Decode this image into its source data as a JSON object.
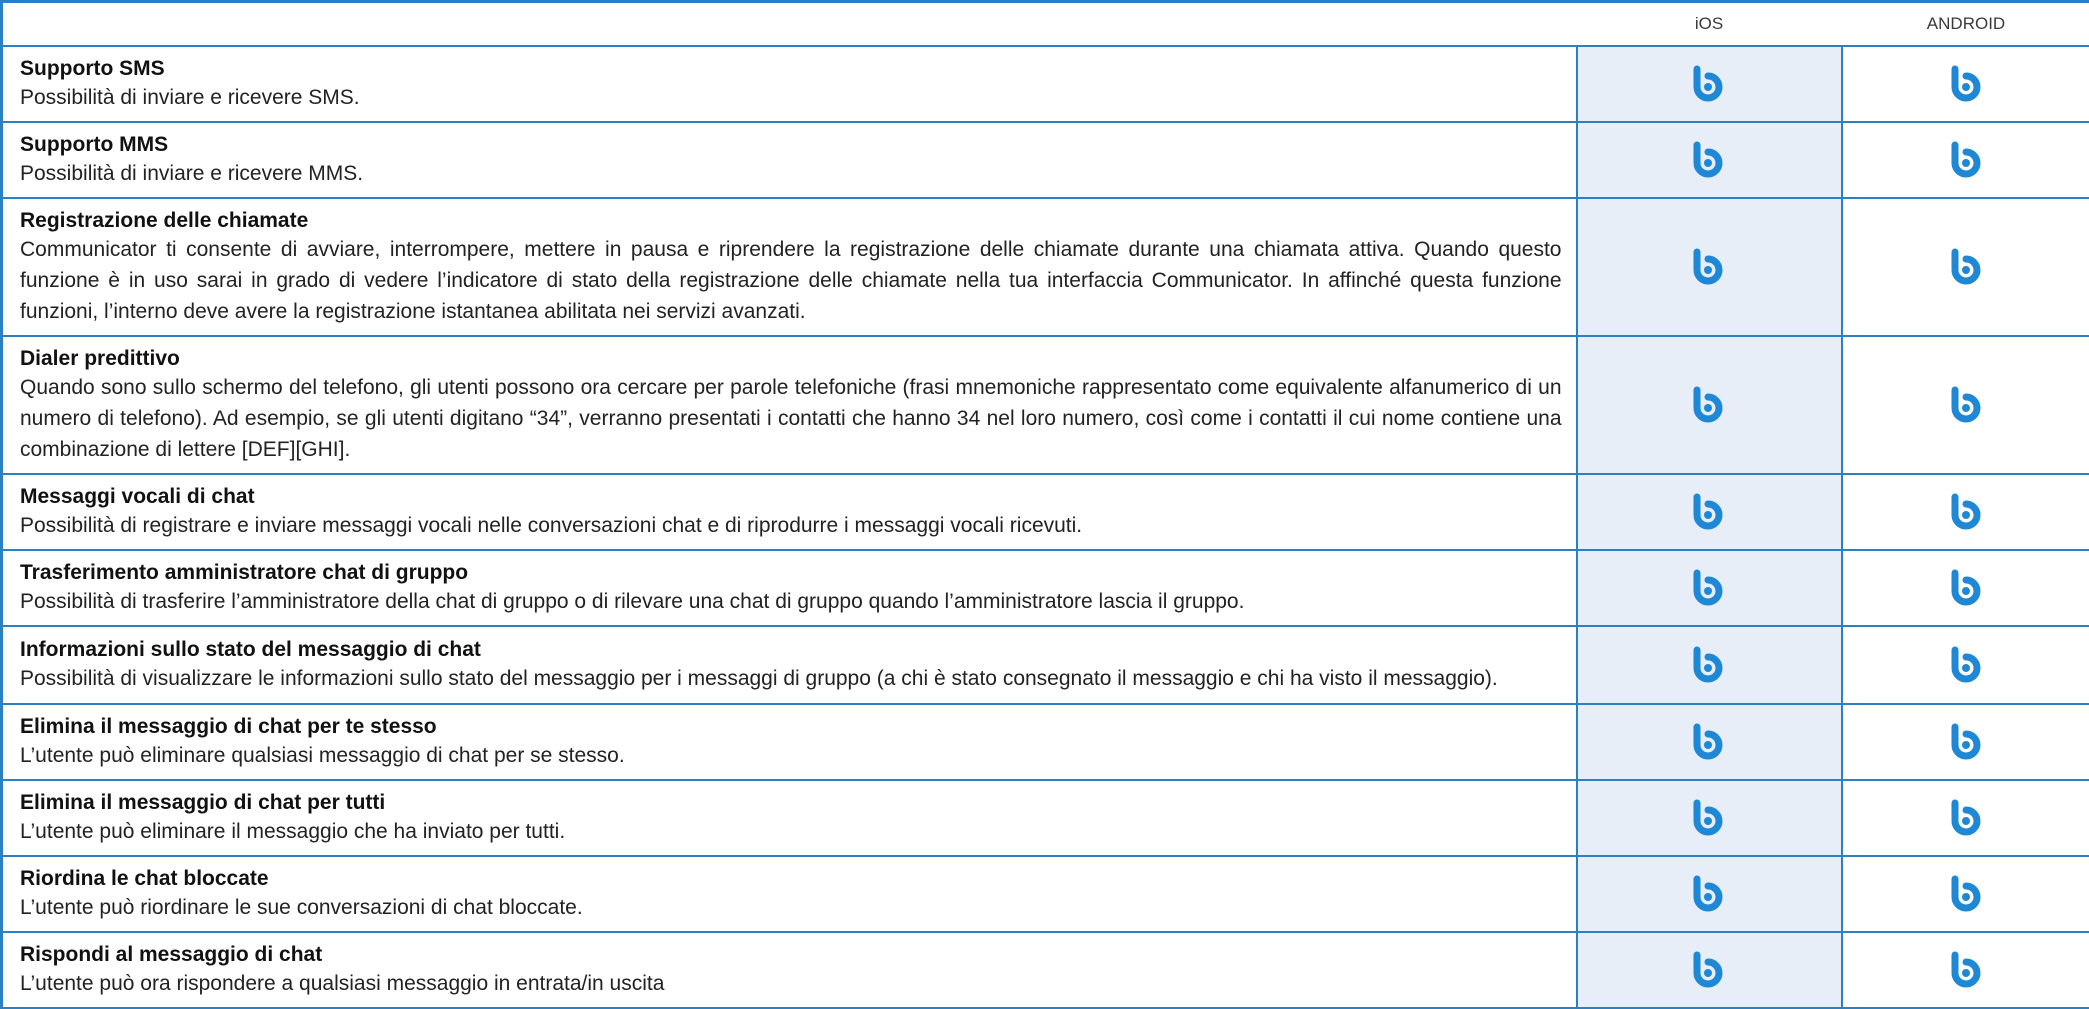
{
  "header": {
    "feature_label": "",
    "ios_label": "iOS",
    "android_label": "ANDROID"
  },
  "brand_color": "#1e88d6",
  "icon": "b-logo-icon",
  "rows": [
    {
      "title": "Supporto SMS",
      "description": "Possibilità di inviare e ricevere SMS.",
      "ios": true,
      "android": true
    },
    {
      "title": "Supporto MMS",
      "description": "Possibilità di inviare e ricevere MMS.",
      "ios": true,
      "android": true
    },
    {
      "title": "Registrazione delle chiamate",
      "description": "Communicator ti consente di avviare, interrompere, mettere in pausa e riprendere la registrazione delle chiamate durante una chiamata attiva. Quando questo funzione è in uso sarai in grado di vedere l’indicatore di stato della registrazione delle chiamate nella tua interfaccia Communicator. In affinché questa funzione funzioni, l’interno deve avere la registrazione istantanea abilitata nei servizi avanzati.",
      "ios": true,
      "android": true
    },
    {
      "title": "Dialer predittivo",
      "description": "Quando sono sullo schermo del telefono, gli utenti possono ora cercare per parole telefoniche (frasi mnemoniche rappresentato come equivalente alfanumerico di un numero di telefono). Ad esempio, se gli utenti digitano “34”, verranno presentati i contatti che hanno 34 nel loro numero, così come i contatti il cui nome contiene una combinazione di lettere [DEF][GHI].",
      "ios": true,
      "android": true
    },
    {
      "title": "Messaggi vocali di chat",
      "description": "Possibilità di registrare e inviare messaggi vocali nelle conversazioni chat e di riprodurre i messaggi vocali ricevuti.",
      "ios": true,
      "android": true
    },
    {
      "title": "Trasferimento amministratore chat di gruppo",
      "description": "Possibilità di trasferire l’amministratore della chat di gruppo o di rilevare una chat di gruppo quando l’amministratore lascia il gruppo.",
      "ios": true,
      "android": true
    },
    {
      "title": "Informazioni sullo stato del messaggio di chat",
      "description": "Possibilità di visualizzare le informazioni sullo stato del messaggio per i messaggi di gruppo (a chi è stato consegnato il messaggio e chi ha visto il messaggio).",
      "ios": true,
      "android": true
    },
    {
      "title": "Elimina il messaggio di chat per te stesso",
      "description": "L’utente può eliminare qualsiasi messaggio di chat per se stesso.",
      "ios": true,
      "android": true
    },
    {
      "title": "Elimina il messaggio di chat per tutti",
      "description": "L’utente può eliminare il messaggio che ha inviato per tutti.",
      "ios": true,
      "android": true
    },
    {
      "title": "Riordina le chat bloccate",
      "description": "L’utente può riordinare le sue conversazioni di chat bloccate.",
      "ios": true,
      "android": true
    },
    {
      "title": "Rispondi al messaggio di chat",
      "description": "L’utente può ora rispondere a qualsiasi messaggio in entrata/in uscita",
      "ios": true,
      "android": true
    }
  ]
}
